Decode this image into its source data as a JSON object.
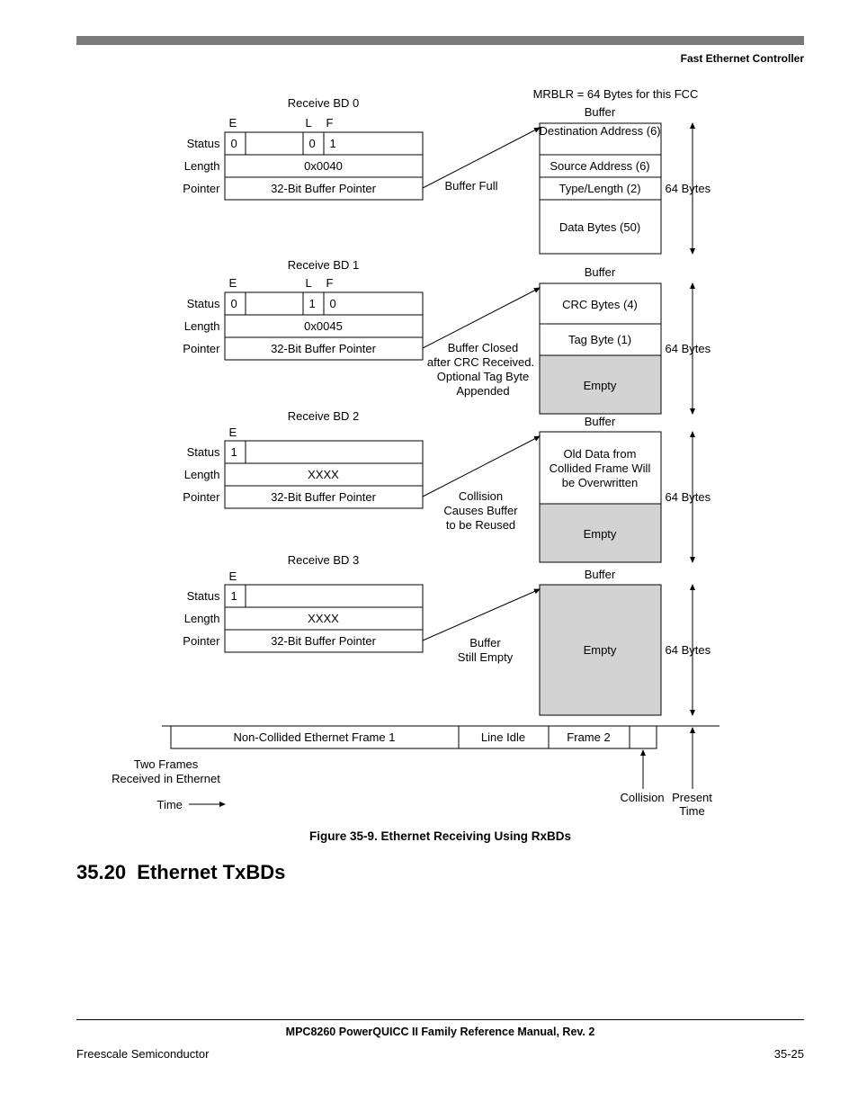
{
  "header": {
    "right": "Fast Ethernet Controller"
  },
  "fig": {
    "mrblr": "MRBLR = 64 Bytes for this FCC",
    "bd0": {
      "title": "Receive BD 0",
      "E": "E",
      "L": "L",
      "F": "F",
      "status_label": "Status",
      "length_label": "Length",
      "pointer_label": "Pointer",
      "e_val": "0",
      "l_val": "0",
      "f_val": "1",
      "length_val": "0x0040",
      "pointer_val": "32-Bit Buffer Pointer",
      "note": "Buffer Full"
    },
    "bd1": {
      "title": "Receive BD 1",
      "E": "E",
      "L": "L",
      "F": "F",
      "status_label": "Status",
      "length_label": "Length",
      "pointer_label": "Pointer",
      "e_val": "0",
      "l_val": "1",
      "f_val": "0",
      "length_val": "0x0045",
      "pointer_val": "32-Bit Buffer Pointer",
      "note1": "Buffer Closed",
      "note2": "after CRC Received.",
      "note3": "Optional Tag Byte",
      "note4": "Appended"
    },
    "bd2": {
      "title": "Receive BD 2",
      "E": "E",
      "status_label": "Status",
      "length_label": "Length",
      "pointer_label": "Pointer",
      "e_val": "1",
      "length_val": "XXXX",
      "pointer_val": "32-Bit Buffer Pointer",
      "note1": "Collision",
      "note2": "Causes Buffer",
      "note3": "to be Reused"
    },
    "bd3": {
      "title": "Receive BD 3",
      "E": "E",
      "status_label": "Status",
      "length_label": "Length",
      "pointer_label": "Pointer",
      "e_val": "1",
      "length_val": "XXXX",
      "pointer_val": "32-Bit Buffer Pointer",
      "note1": "Buffer",
      "note2": "Still Empty"
    },
    "buf0": {
      "title": "Buffer",
      "row1": "Destination Address (6)",
      "row2": "Source Address (6)",
      "row3": "Type/Length (2)",
      "row4": "Data Bytes (50)",
      "bytes": "64 Bytes"
    },
    "buf1": {
      "title": "Buffer",
      "row1": "CRC Bytes (4)",
      "row2": "Tag Byte (1)",
      "row3": "Empty",
      "bytes": "64 Bytes"
    },
    "buf2": {
      "title": "Buffer",
      "row1a": "Old Data from",
      "row1b": "Collided Frame Will",
      "row1c": "be Overwritten",
      "row2": "Empty",
      "bytes": "64 Bytes"
    },
    "buf3": {
      "title": "Buffer",
      "row1": "Empty",
      "bytes": "64 Bytes"
    },
    "timeline": {
      "frame1": "Non-Collided Ethernet Frame 1",
      "idle": "Line Idle",
      "frame2": "Frame 2",
      "twoframes1": "Two Frames",
      "twoframes2": "Received in Ethernet",
      "time": "Time",
      "collision": "Collision",
      "present": "Present Time"
    },
    "caption": "Figure 35-9. Ethernet Receiving Using RxBDs"
  },
  "section": {
    "num": "35.20",
    "title": "Ethernet TxBDs"
  },
  "footer": {
    "manual": "MPC8260 PowerQUICC II Family Reference Manual, Rev. 2",
    "left": "Freescale Semiconductor",
    "right": "35-25"
  }
}
